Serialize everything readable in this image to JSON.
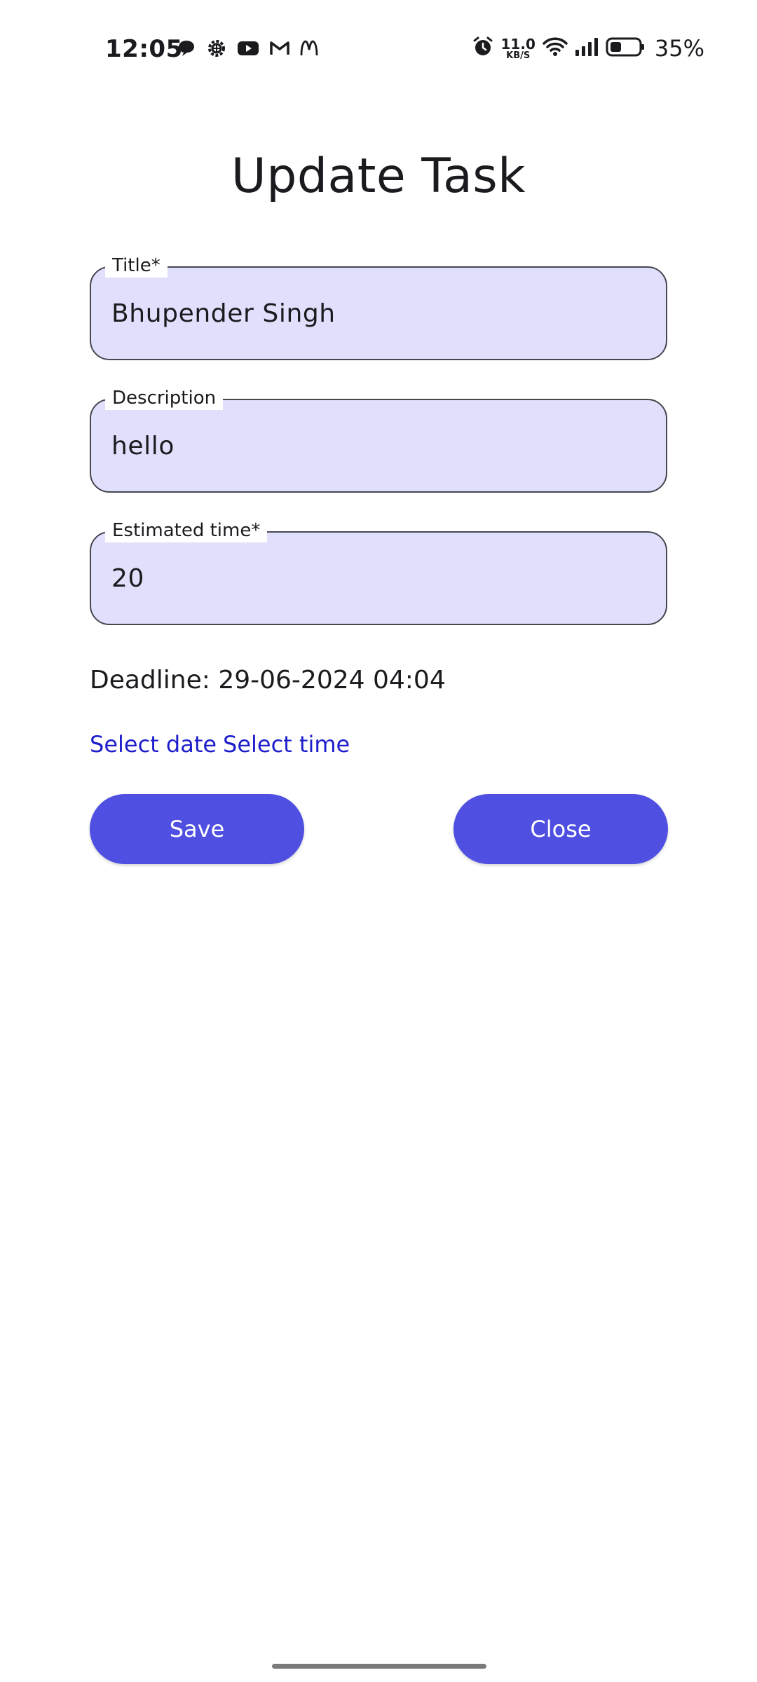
{
  "status_bar": {
    "time": "12:05",
    "left_icons": [
      "chat-icon",
      "gear-icon",
      "youtube-icon",
      "gmail-icon",
      "mcdonalds-icon"
    ],
    "net_speed_value": "11.0",
    "net_speed_unit": "KB/S",
    "battery_percent": "35%"
  },
  "page": {
    "title": "Update Task"
  },
  "form": {
    "title": {
      "label": "Title*",
      "value": "Bhupender Singh"
    },
    "description": {
      "label": "Description",
      "value": "hello"
    },
    "estimated_time": {
      "label": "Estimated time*",
      "value": "20"
    },
    "deadline_text": "Deadline: 29-06-2024 04:04",
    "select_date_label": "Select date",
    "select_time_label": "Select time",
    "save_label": "Save",
    "close_label": "Close"
  },
  "colors": {
    "field_fill": "#e0e0fc",
    "field_border": "#46464f",
    "button": "#4f4fe2",
    "link": "#1d1dcc"
  }
}
